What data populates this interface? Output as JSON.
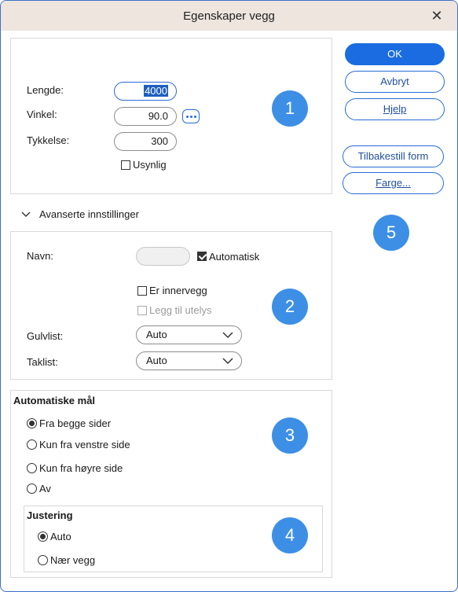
{
  "window": {
    "title": "Egenskaper vegg"
  },
  "wall": {
    "length_label": "Lengde:",
    "length_value": "4000",
    "angle_label": "Vinkel:",
    "angle_value": "90.0",
    "thickness_label": "Tykkelse:",
    "thickness_value": "300",
    "invisible_label": "Usynlig"
  },
  "advanced": {
    "toggle_label": "Avanserte innstillinger",
    "name_label": "Navn:",
    "name_value": "",
    "automatic_label": "Automatisk",
    "inner_wall_label": "Er innervegg",
    "add_outside_label": "Legg til utelys",
    "floor_trim_label": "Gulvlist:",
    "floor_trim_value": "Auto",
    "ceiling_trim_label": "Taklist:",
    "ceiling_trim_value": "Auto"
  },
  "auto_dimensions": {
    "heading": "Automatiske mål",
    "options": [
      "Fra begge sider",
      "Kun fra venstre side",
      "Kun fra høyre side",
      "Av"
    ],
    "selected": "Fra begge sider"
  },
  "alignment": {
    "heading": "Justering",
    "options": [
      "Auto",
      "Nær vegg"
    ],
    "selected": "Auto"
  },
  "buttons": {
    "ok": "OK",
    "cancel": "Avbryt",
    "help": "Hjelp",
    "reset_shape": "Tilbakestill form",
    "color": "Farge..."
  },
  "badges": [
    "1",
    "2",
    "3",
    "4",
    "5"
  ],
  "colors": {
    "accent": "#1a6ce0",
    "badge": "#3d8fe6",
    "titlebar": "#ede5de"
  }
}
